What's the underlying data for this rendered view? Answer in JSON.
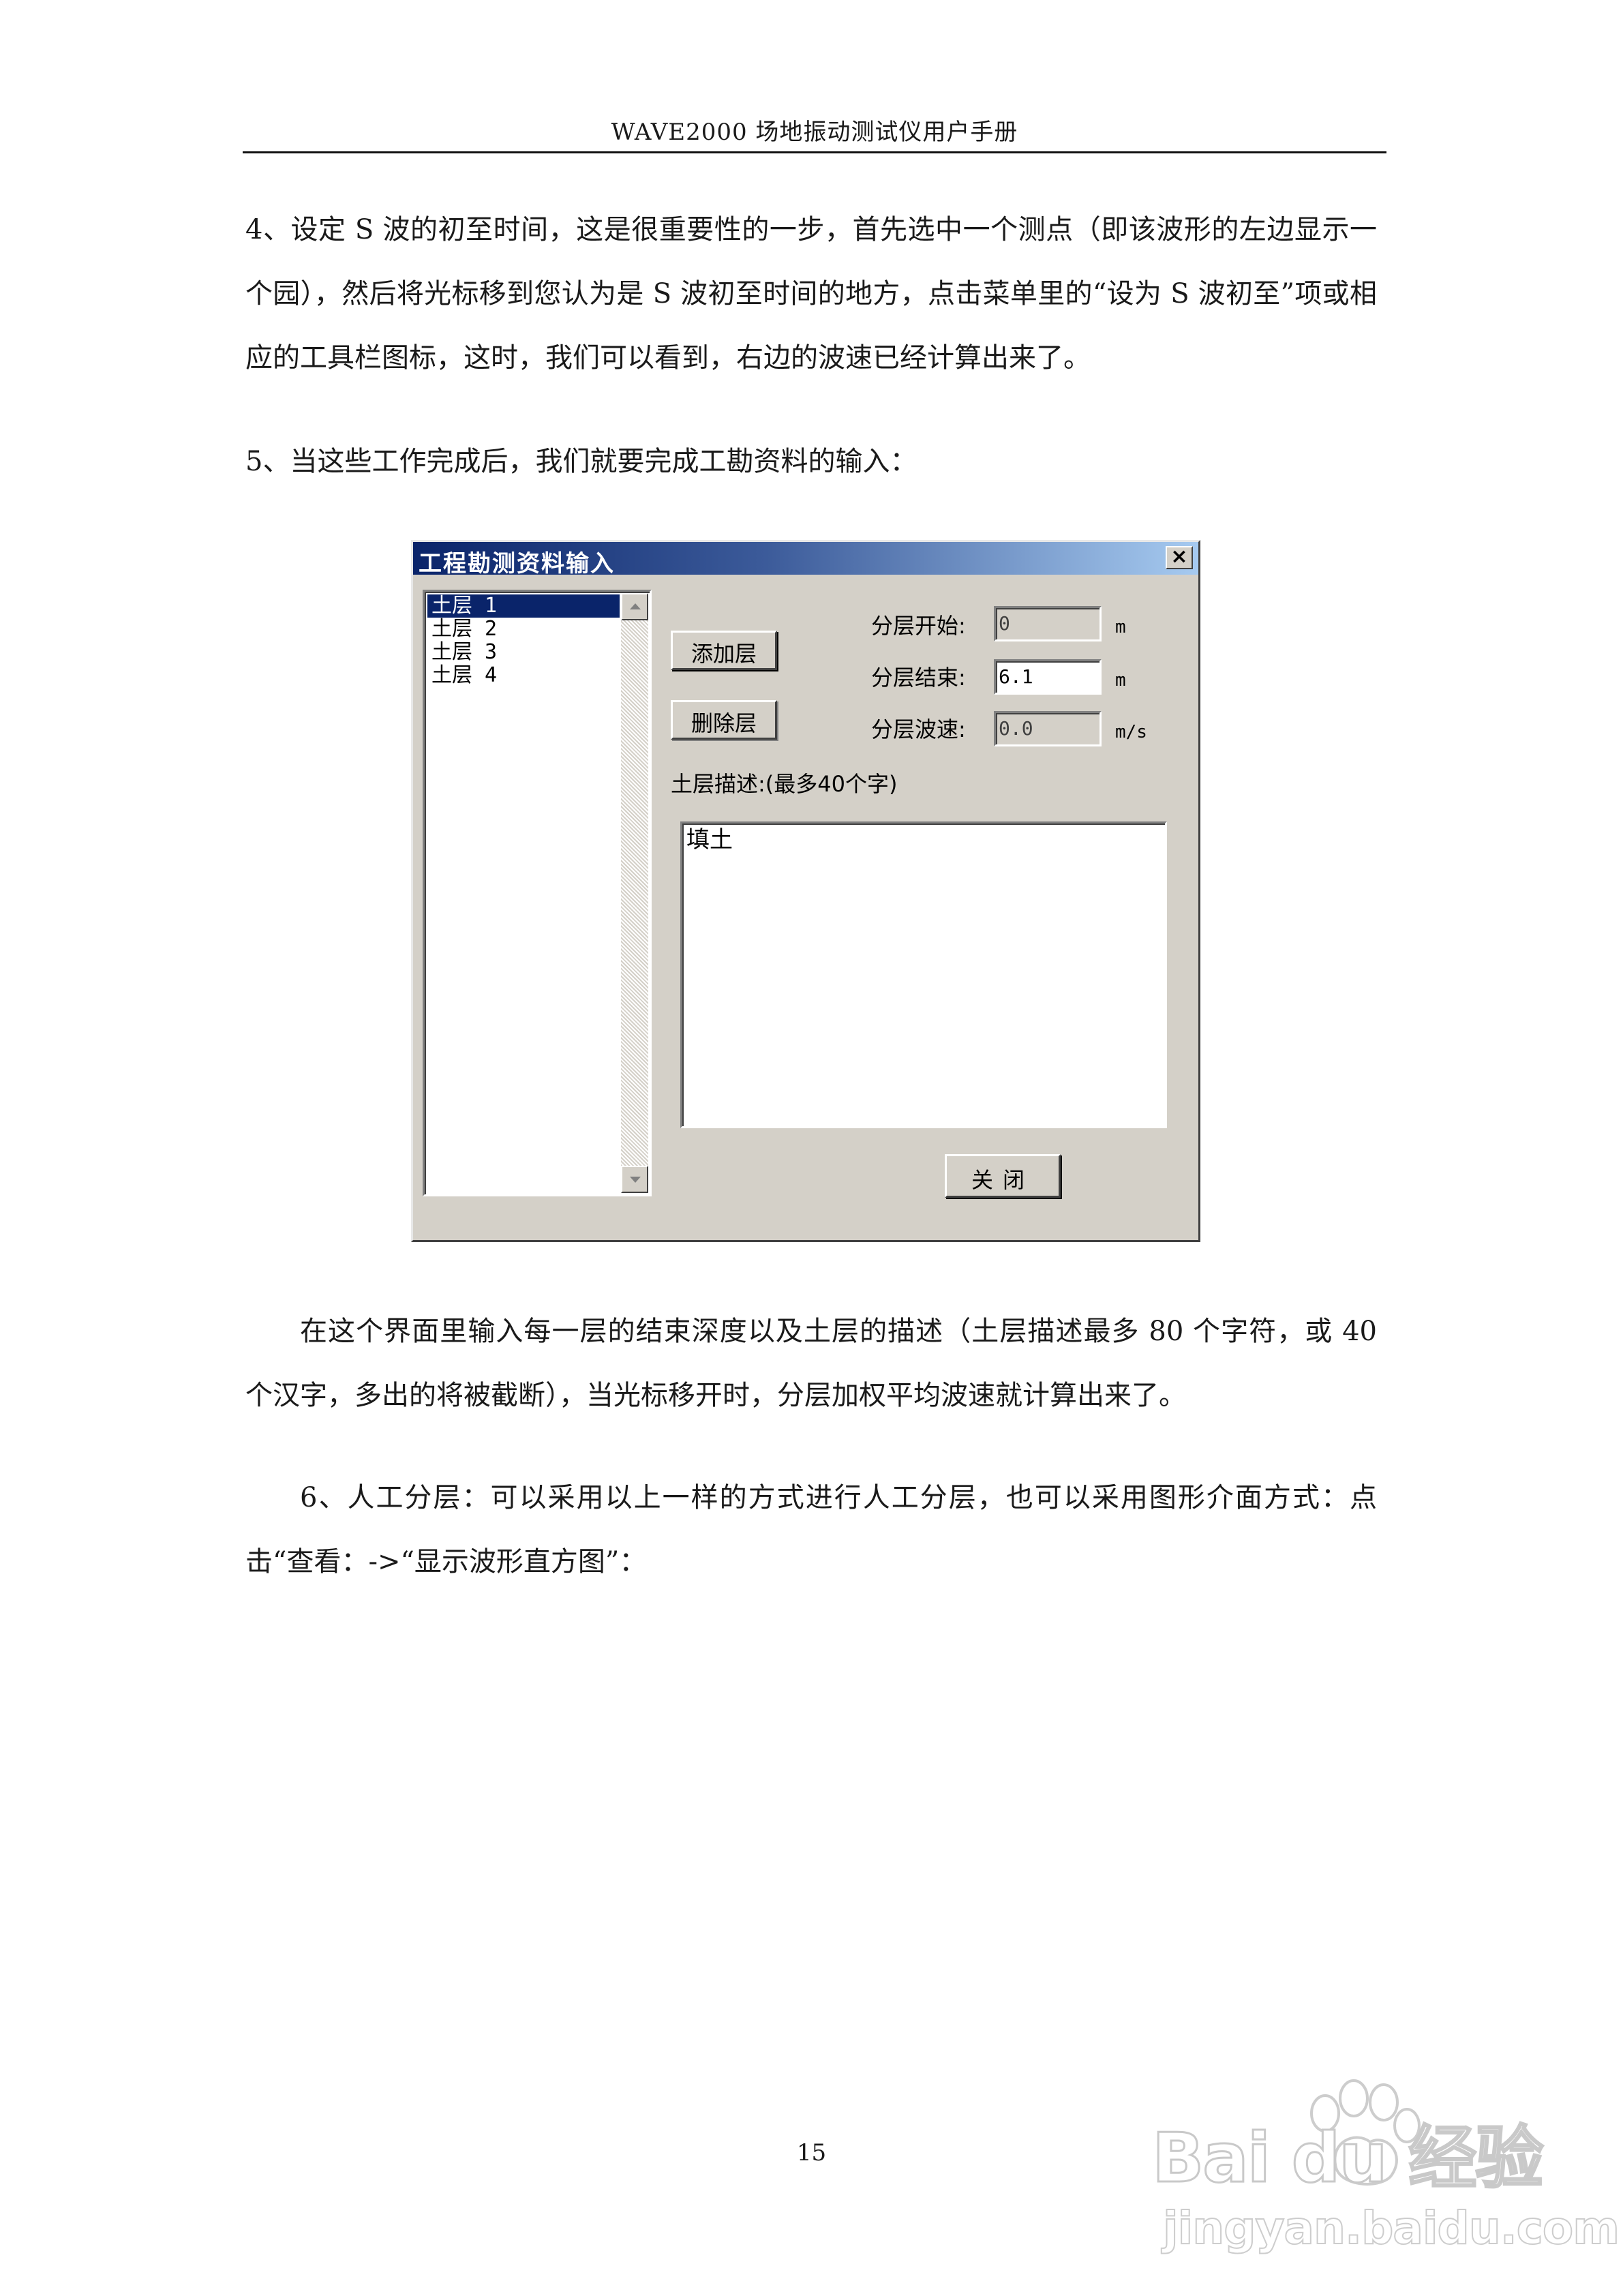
{
  "header": {
    "title": "WAVE2000 场地振动测试仪用户手册"
  },
  "paragraphs": {
    "p4": "4、设定 S 波的初至时间，这是很重要性的一步，首先选中一个测点（即该波形的左边显示一个园），然后将光标移到您认为是 S 波初至时间的地方，点击菜单里的“设为 S 波初至”项或相应的工具栏图标，这时，我们可以看到，右边的波速已经计算出来了。",
    "p5": "5、当这些工作完成后，我们就要完成工勘资料的输入：",
    "p_after": "在这个界面里输入每一层的结束深度以及土层的描述（土层描述最多 80 个字符，或 40 个汉字，多出的将被截断），当光标移开时，分层加权平均波速就计算出来了。",
    "p6": "6、人工分层：可以采用以上一样的方式进行人工分层，也可以采用图形介面方式：点击“查看：->“显示波形直方图”："
  },
  "dialog": {
    "title": "工程勘测资料输入",
    "close_glyph": "×",
    "layers": [
      "土层 1",
      "土层 2",
      "土层 3",
      "土层 4"
    ],
    "selected_index": 0,
    "add_button": "添加层",
    "delete_button": "删除层",
    "start_label": "分层开始:",
    "start_value": "0",
    "start_unit": "m",
    "end_label": "分层结束:",
    "end_value": "6.1",
    "end_unit": "m",
    "velocity_label": "分层波速:",
    "velocity_value": "0.0",
    "velocity_unit": "m/s",
    "desc_label": "土层描述:(最多40个字)",
    "desc_value": "填土",
    "ok_button": "关闭"
  },
  "page_number": "15",
  "watermark": {
    "main": "Bai du 经验",
    "sub": "jingyan.baidu.com"
  }
}
